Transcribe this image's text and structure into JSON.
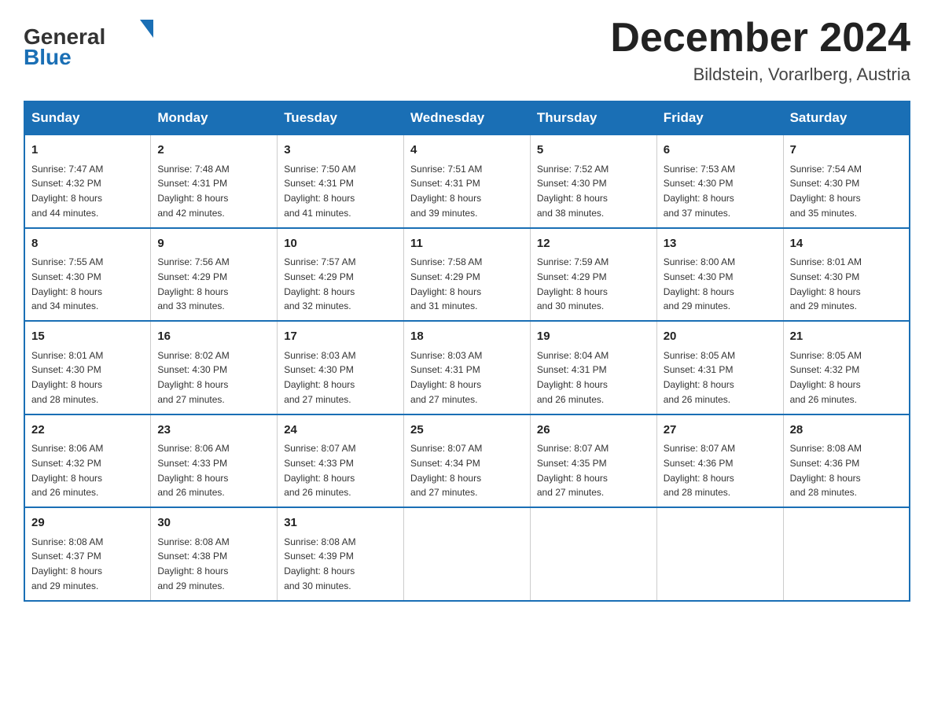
{
  "header": {
    "logo_general": "General",
    "logo_blue": "Blue",
    "month_title": "December 2024",
    "subtitle": "Bildstein, Vorarlberg, Austria"
  },
  "days_of_week": [
    "Sunday",
    "Monday",
    "Tuesday",
    "Wednesday",
    "Thursday",
    "Friday",
    "Saturday"
  ],
  "weeks": [
    [
      {
        "day": "1",
        "sunrise": "7:47 AM",
        "sunset": "4:32 PM",
        "daylight": "8 hours and 44 minutes."
      },
      {
        "day": "2",
        "sunrise": "7:48 AM",
        "sunset": "4:31 PM",
        "daylight": "8 hours and 42 minutes."
      },
      {
        "day": "3",
        "sunrise": "7:50 AM",
        "sunset": "4:31 PM",
        "daylight": "8 hours and 41 minutes."
      },
      {
        "day": "4",
        "sunrise": "7:51 AM",
        "sunset": "4:31 PM",
        "daylight": "8 hours and 39 minutes."
      },
      {
        "day": "5",
        "sunrise": "7:52 AM",
        "sunset": "4:30 PM",
        "daylight": "8 hours and 38 minutes."
      },
      {
        "day": "6",
        "sunrise": "7:53 AM",
        "sunset": "4:30 PM",
        "daylight": "8 hours and 37 minutes."
      },
      {
        "day": "7",
        "sunrise": "7:54 AM",
        "sunset": "4:30 PM",
        "daylight": "8 hours and 35 minutes."
      }
    ],
    [
      {
        "day": "8",
        "sunrise": "7:55 AM",
        "sunset": "4:30 PM",
        "daylight": "8 hours and 34 minutes."
      },
      {
        "day": "9",
        "sunrise": "7:56 AM",
        "sunset": "4:29 PM",
        "daylight": "8 hours and 33 minutes."
      },
      {
        "day": "10",
        "sunrise": "7:57 AM",
        "sunset": "4:29 PM",
        "daylight": "8 hours and 32 minutes."
      },
      {
        "day": "11",
        "sunrise": "7:58 AM",
        "sunset": "4:29 PM",
        "daylight": "8 hours and 31 minutes."
      },
      {
        "day": "12",
        "sunrise": "7:59 AM",
        "sunset": "4:29 PM",
        "daylight": "8 hours and 30 minutes."
      },
      {
        "day": "13",
        "sunrise": "8:00 AM",
        "sunset": "4:30 PM",
        "daylight": "8 hours and 29 minutes."
      },
      {
        "day": "14",
        "sunrise": "8:01 AM",
        "sunset": "4:30 PM",
        "daylight": "8 hours and 29 minutes."
      }
    ],
    [
      {
        "day": "15",
        "sunrise": "8:01 AM",
        "sunset": "4:30 PM",
        "daylight": "8 hours and 28 minutes."
      },
      {
        "day": "16",
        "sunrise": "8:02 AM",
        "sunset": "4:30 PM",
        "daylight": "8 hours and 27 minutes."
      },
      {
        "day": "17",
        "sunrise": "8:03 AM",
        "sunset": "4:30 PM",
        "daylight": "8 hours and 27 minutes."
      },
      {
        "day": "18",
        "sunrise": "8:03 AM",
        "sunset": "4:31 PM",
        "daylight": "8 hours and 27 minutes."
      },
      {
        "day": "19",
        "sunrise": "8:04 AM",
        "sunset": "4:31 PM",
        "daylight": "8 hours and 26 minutes."
      },
      {
        "day": "20",
        "sunrise": "8:05 AM",
        "sunset": "4:31 PM",
        "daylight": "8 hours and 26 minutes."
      },
      {
        "day": "21",
        "sunrise": "8:05 AM",
        "sunset": "4:32 PM",
        "daylight": "8 hours and 26 minutes."
      }
    ],
    [
      {
        "day": "22",
        "sunrise": "8:06 AM",
        "sunset": "4:32 PM",
        "daylight": "8 hours and 26 minutes."
      },
      {
        "day": "23",
        "sunrise": "8:06 AM",
        "sunset": "4:33 PM",
        "daylight": "8 hours and 26 minutes."
      },
      {
        "day": "24",
        "sunrise": "8:07 AM",
        "sunset": "4:33 PM",
        "daylight": "8 hours and 26 minutes."
      },
      {
        "day": "25",
        "sunrise": "8:07 AM",
        "sunset": "4:34 PM",
        "daylight": "8 hours and 27 minutes."
      },
      {
        "day": "26",
        "sunrise": "8:07 AM",
        "sunset": "4:35 PM",
        "daylight": "8 hours and 27 minutes."
      },
      {
        "day": "27",
        "sunrise": "8:07 AM",
        "sunset": "4:36 PM",
        "daylight": "8 hours and 28 minutes."
      },
      {
        "day": "28",
        "sunrise": "8:08 AM",
        "sunset": "4:36 PM",
        "daylight": "8 hours and 28 minutes."
      }
    ],
    [
      {
        "day": "29",
        "sunrise": "8:08 AM",
        "sunset": "4:37 PM",
        "daylight": "8 hours and 29 minutes."
      },
      {
        "day": "30",
        "sunrise": "8:08 AM",
        "sunset": "4:38 PM",
        "daylight": "8 hours and 29 minutes."
      },
      {
        "day": "31",
        "sunrise": "8:08 AM",
        "sunset": "4:39 PM",
        "daylight": "8 hours and 30 minutes."
      },
      null,
      null,
      null,
      null
    ]
  ],
  "labels": {
    "sunrise": "Sunrise:",
    "sunset": "Sunset:",
    "daylight": "Daylight:"
  }
}
